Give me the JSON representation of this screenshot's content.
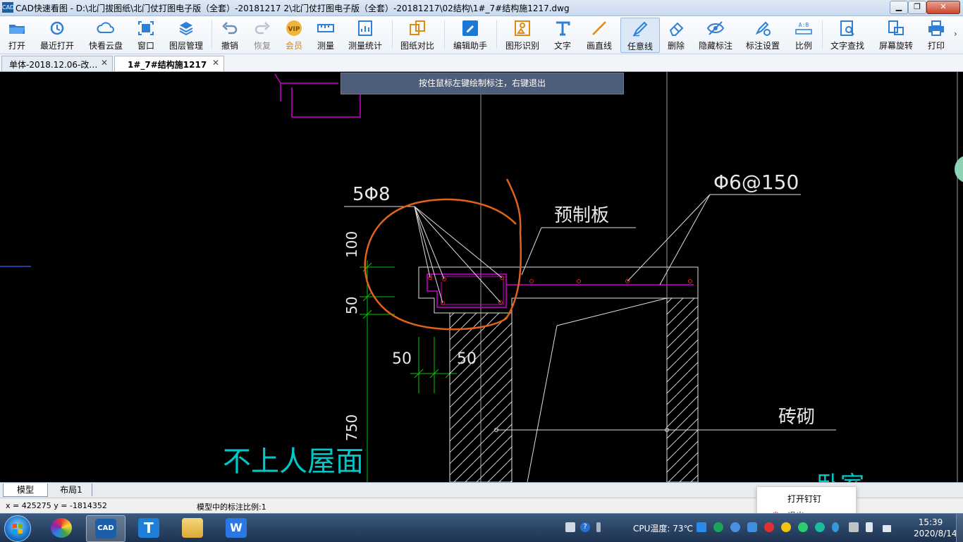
{
  "window": {
    "app_icon_text": "CAD",
    "title": "CAD快速看图 - D:\\北门拔图纸\\北门仗打图电子版（全套）-20181217 2\\北门仗打图电子版（全套）-20181217\\02结构\\1#_7#结构施1217.dwg",
    "btn_min": "▁",
    "btn_max": "❐",
    "btn_close": "✕"
  },
  "toolbar": {
    "items": [
      {
        "label": "打开",
        "icon": "open-folder-icon"
      },
      {
        "label": "最近打开",
        "icon": "history-icon"
      },
      {
        "label": "快看云盘",
        "icon": "cloud-icon"
      },
      {
        "label": "窗口",
        "icon": "window-fit-icon"
      },
      {
        "label": "图层管理",
        "icon": "layers-icon"
      },
      {
        "label": "撤销",
        "icon": "undo-icon"
      },
      {
        "label": "恢复",
        "icon": "redo-icon",
        "disabled": true
      },
      {
        "label": "会员",
        "icon": "vip-icon"
      },
      {
        "label": "测量",
        "icon": "measure-icon"
      },
      {
        "label": "测量统计",
        "icon": "measure-stats-icon"
      },
      {
        "label": "图纸对比",
        "icon": "compare-icon"
      },
      {
        "label": "编辑助手",
        "icon": "edit-assistant-icon"
      },
      {
        "label": "图形识别",
        "icon": "shape-recognition-icon"
      },
      {
        "label": "文字",
        "icon": "text-icon"
      },
      {
        "label": "画直线",
        "icon": "line-icon"
      },
      {
        "label": "任意线",
        "icon": "freehand-pen-icon",
        "active": true
      },
      {
        "label": "删除",
        "icon": "eraser-icon"
      },
      {
        "label": "隐藏标注",
        "icon": "hide-eye-icon"
      },
      {
        "label": "标注设置",
        "icon": "annotation-settings-icon"
      },
      {
        "label": "比例",
        "icon": "scale-icon"
      },
      {
        "label": "文字查找",
        "icon": "text-search-icon"
      },
      {
        "label": "屏幕旋转",
        "icon": "rotate-screen-icon"
      },
      {
        "label": "打印",
        "icon": "printer-icon"
      }
    ],
    "vip_text": "VIP",
    "scale_text": "A:B",
    "more": "›"
  },
  "tabs": [
    {
      "label": "单体-2018.12.06-改…",
      "close": "✕"
    },
    {
      "label": "1#_7#结构施1217",
      "close": "✕",
      "active": true
    }
  ],
  "canvas": {
    "hint": "按住鼠标左键绘制标注，右键退出",
    "labels": {
      "rebar_count": "5Φ8",
      "stirrup": "Φ6@150",
      "precast_slab": "预制板",
      "masonry": "砖砌",
      "roof": "不上人屋面",
      "dim_100": "100",
      "dim_50_v": "50",
      "dim_50_a": "50",
      "dim_50_b": "50",
      "dim_750": "750",
      "bedroom_partial": "卧室"
    },
    "colors": {
      "background": "#000000",
      "annotation": "#e2621c",
      "rebar": "#e000e0",
      "dimension": "#00d000",
      "text": "#ffffff",
      "roof_text": "#00c8c8"
    }
  },
  "layout_tabs": [
    "模型",
    "布局1"
  ],
  "status": {
    "coords": "x = 425275  y = -1814352",
    "scale_label": "模型中的标注比例:1"
  },
  "popup": {
    "item1": "打开钉钉",
    "item2": "退出"
  },
  "taskbar": {
    "apps": [
      {
        "name": "browser",
        "icon": "pinwheel-browser-icon"
      },
      {
        "name": "cad",
        "icon": "cad-viewer-icon",
        "active": true
      },
      {
        "name": "t-app",
        "icon": "t-app-icon"
      },
      {
        "name": "explorer",
        "icon": "file-explorer-icon"
      },
      {
        "name": "wps",
        "icon": "wps-icon"
      }
    ],
    "cpu_temp": "CPU温度: 73℃",
    "time": "15:39",
    "date": "2020/8/14"
  }
}
